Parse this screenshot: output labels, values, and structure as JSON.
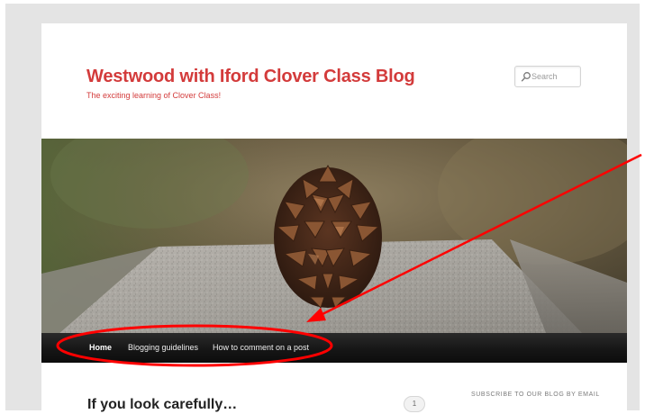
{
  "header": {
    "site_title": "Westwood with Iford Clover Class Blog",
    "site_description": "The exciting learning of Clover Class!",
    "search_placeholder": "Search"
  },
  "nav": {
    "items": [
      {
        "label": "Home",
        "active": true
      },
      {
        "label": "Blogging guidelines",
        "active": false
      },
      {
        "label": "How to comment on a post",
        "active": false
      }
    ]
  },
  "main": {
    "post_title": "If you look carefully…",
    "comment_count": "1"
  },
  "sidebar": {
    "widget_title": "SUBSCRIBE TO OUR BLOG BY EMAIL"
  },
  "colors": {
    "title_red": "#d33b3b",
    "nav_background": "#151515",
    "annotation_red": "#ff0000"
  },
  "icons": {
    "search": "search-icon",
    "header_image": "pine-cone-on-granite"
  }
}
